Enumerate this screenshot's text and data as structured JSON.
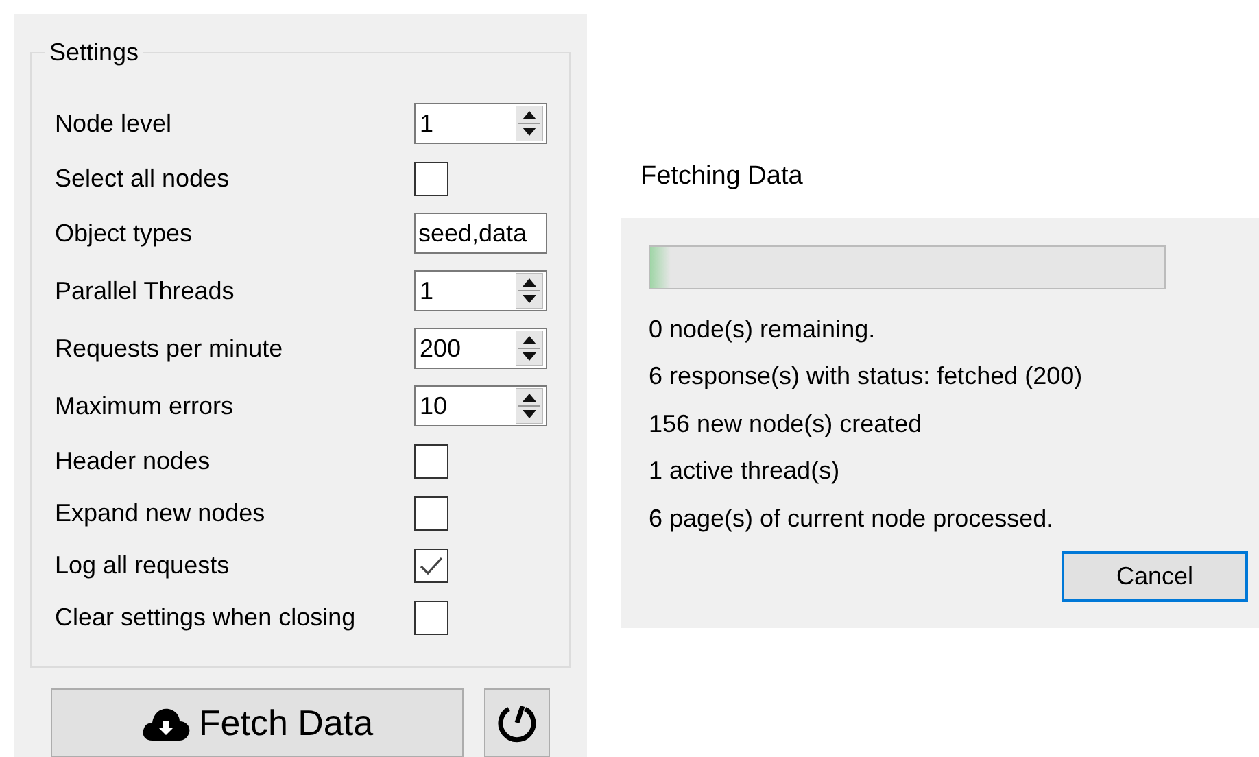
{
  "settings": {
    "title": "Settings",
    "rows": [
      {
        "label": "Node level",
        "kind": "spin",
        "value": "1"
      },
      {
        "label": "Select all nodes",
        "kind": "checkbox",
        "checked": false
      },
      {
        "label": "Object types",
        "kind": "text",
        "value": "seed,data"
      },
      {
        "label": "Parallel Threads",
        "kind": "spin",
        "value": "1"
      },
      {
        "label": "Requests per minute",
        "kind": "spin",
        "value": "200"
      },
      {
        "label": "Maximum errors",
        "kind": "spin",
        "value": "10"
      },
      {
        "label": "Header nodes",
        "kind": "checkbox",
        "checked": false
      },
      {
        "label": "Expand new nodes",
        "kind": "checkbox",
        "checked": false
      },
      {
        "label": "Log all requests",
        "kind": "checkbox",
        "checked": true
      },
      {
        "label": "Clear settings when closing",
        "kind": "checkbox",
        "checked": false
      }
    ],
    "fetch_button": "Fetch Data"
  },
  "progress_dialog": {
    "title": "Fetching Data",
    "level": 0.04,
    "lines": [
      "0 node(s) remaining.",
      "6 response(s) with status: fetched (200)",
      "156 new node(s) created",
      "1 active thread(s)",
      "6 page(s) of current node processed."
    ],
    "cancel_button": "Cancel"
  }
}
